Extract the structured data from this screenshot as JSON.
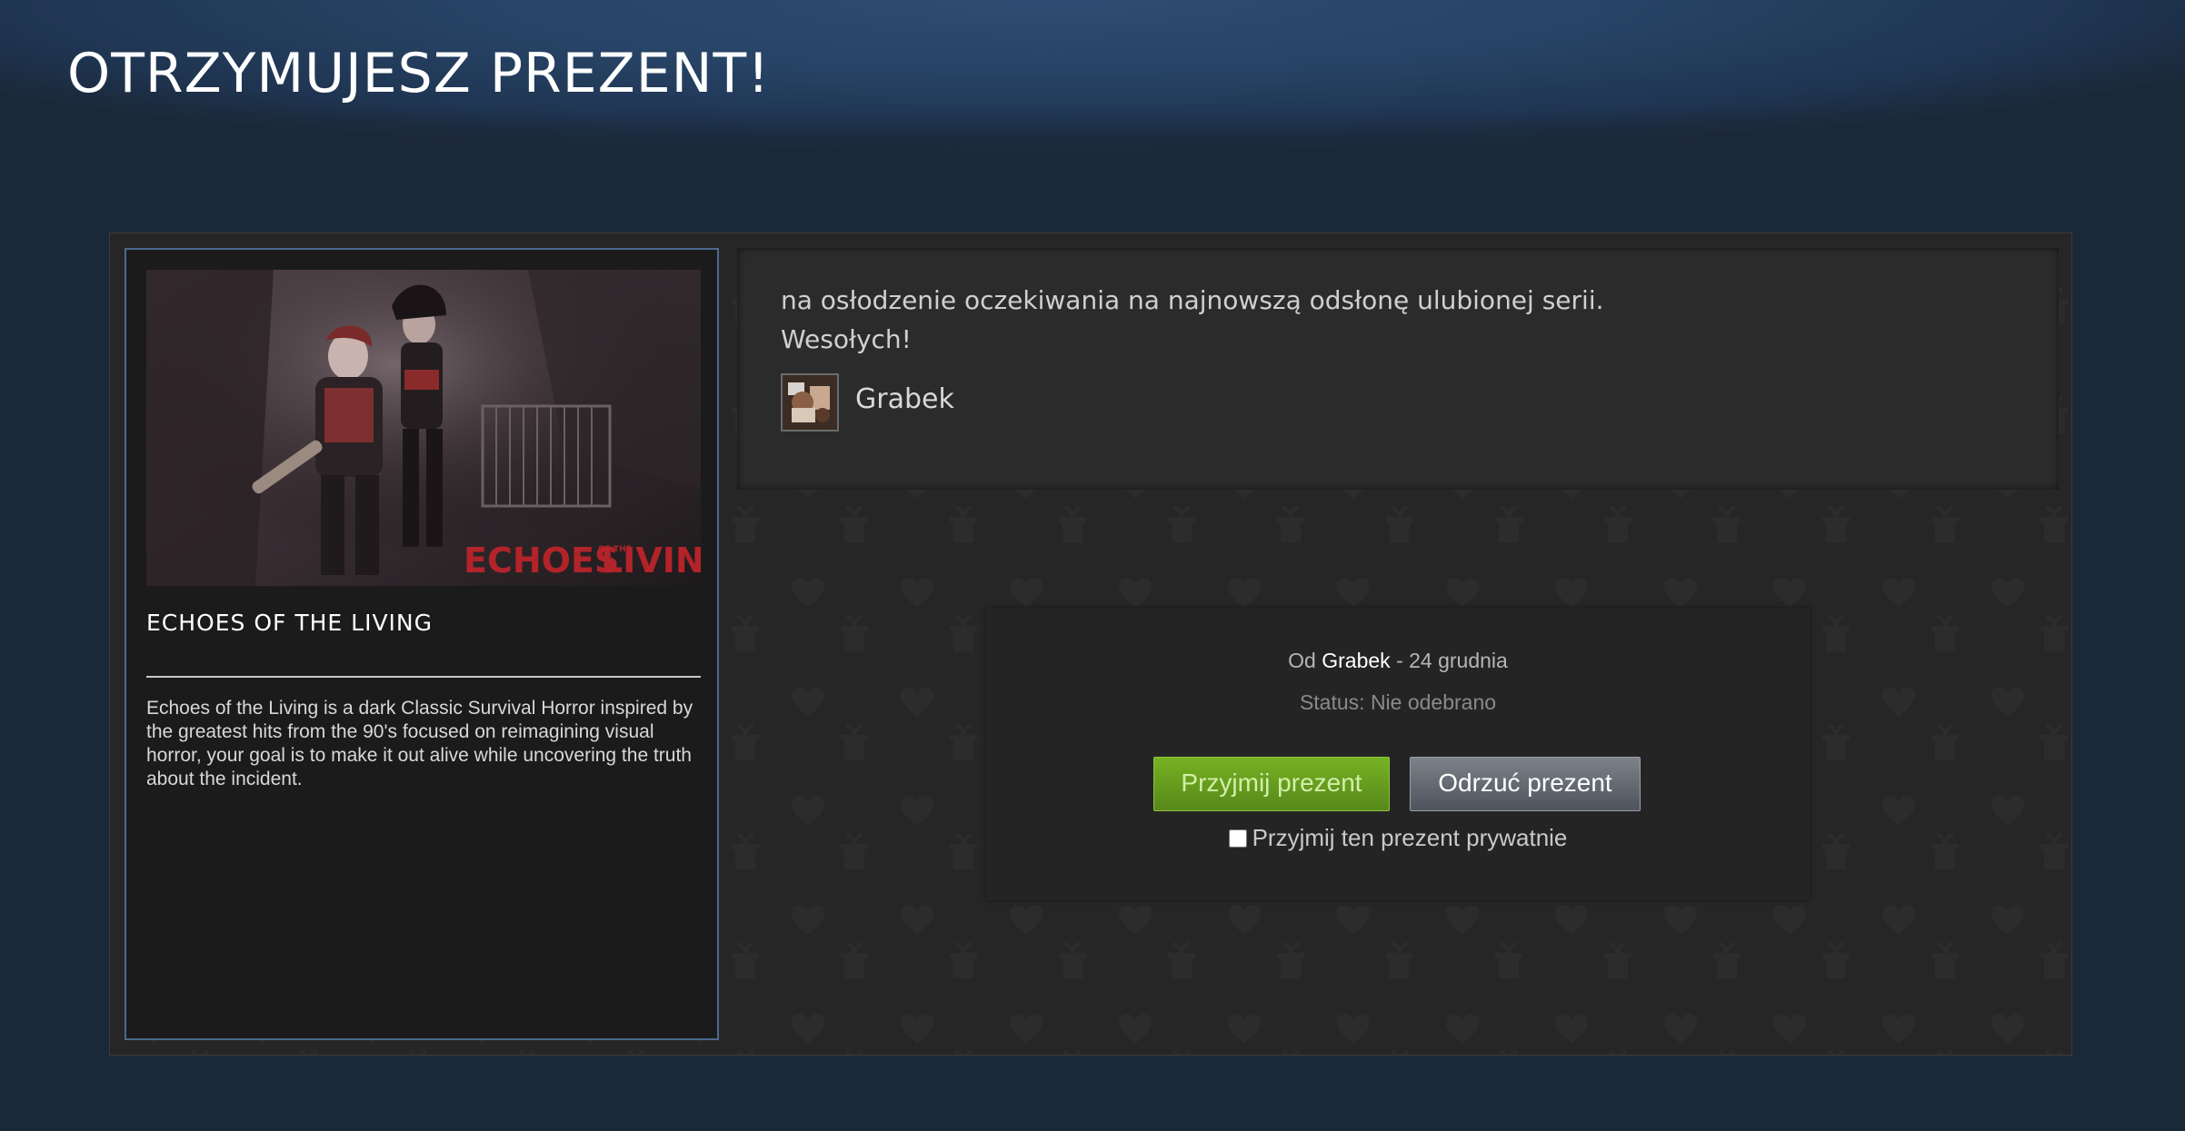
{
  "page": {
    "title": "OTRZYMUJESZ PREZENT!"
  },
  "game": {
    "capsule_logo_line1": "ECHOES",
    "capsule_logo_small": "OF THE",
    "capsule_logo_line2": "LIVING",
    "name": "ECHOES OF THE LIVING",
    "description": "Echoes of the Living is a dark Classic Survival Horror inspired by the greatest hits from the 90's focused on reimagining visual horror, your goal is to make it out alive while uncovering the truth about the incident."
  },
  "message": {
    "text": "na osłodzenie oczekiwania na najnowszą odsłonę ulubionej serii.\nWesołych!",
    "sender_name": "Grabek",
    "avatar_icon": "avatar-image"
  },
  "gift_action": {
    "from_prefix": "Od",
    "from_sender": "Grabek",
    "from_suffix": "- 24 grudnia",
    "status": "Status: Nie odebrano",
    "accept_label": "Przyjmij prezent",
    "decline_label": "Odrzuć prezent",
    "private_label": "Przyjmij ten prezent prywatnie",
    "private_checked": false
  },
  "colors": {
    "page_bg": "#1b2838",
    "accept_button": "#75b022",
    "decline_button": "#6b7078",
    "card_border": "#4a6a8e"
  }
}
